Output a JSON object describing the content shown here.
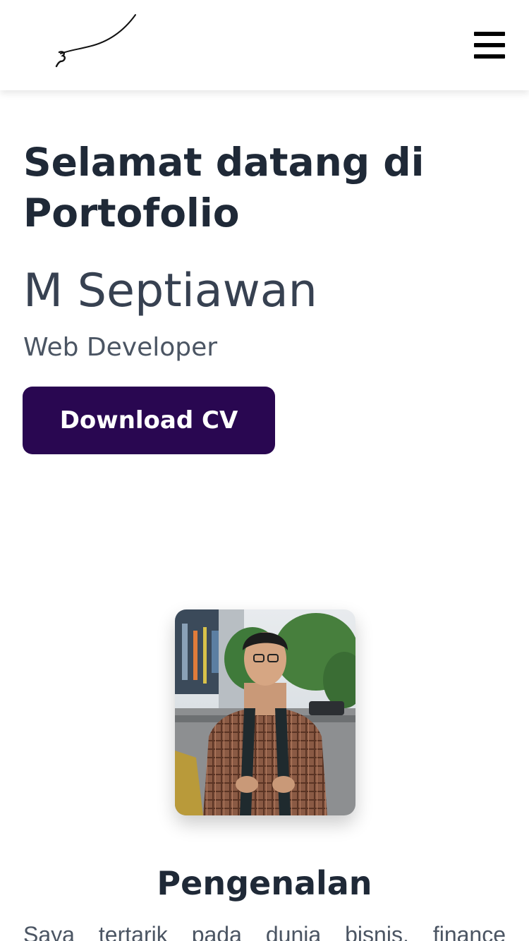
{
  "navbar": {
    "logo_icon": "signature-logo",
    "menu_icon": "hamburger-menu-icon"
  },
  "hero": {
    "title": "Selamat datang di Portofolio",
    "name": "M Septiawan",
    "role": "Web Developer",
    "download_label": "Download CV"
  },
  "about": {
    "title": "Pengenalan",
    "text": "Saya tertarik pada dunia bisnis, finance"
  },
  "colors": {
    "accent": "#290751",
    "heading": "#1f2937",
    "body_text": "#4b5563",
    "background": "#ffffff"
  }
}
